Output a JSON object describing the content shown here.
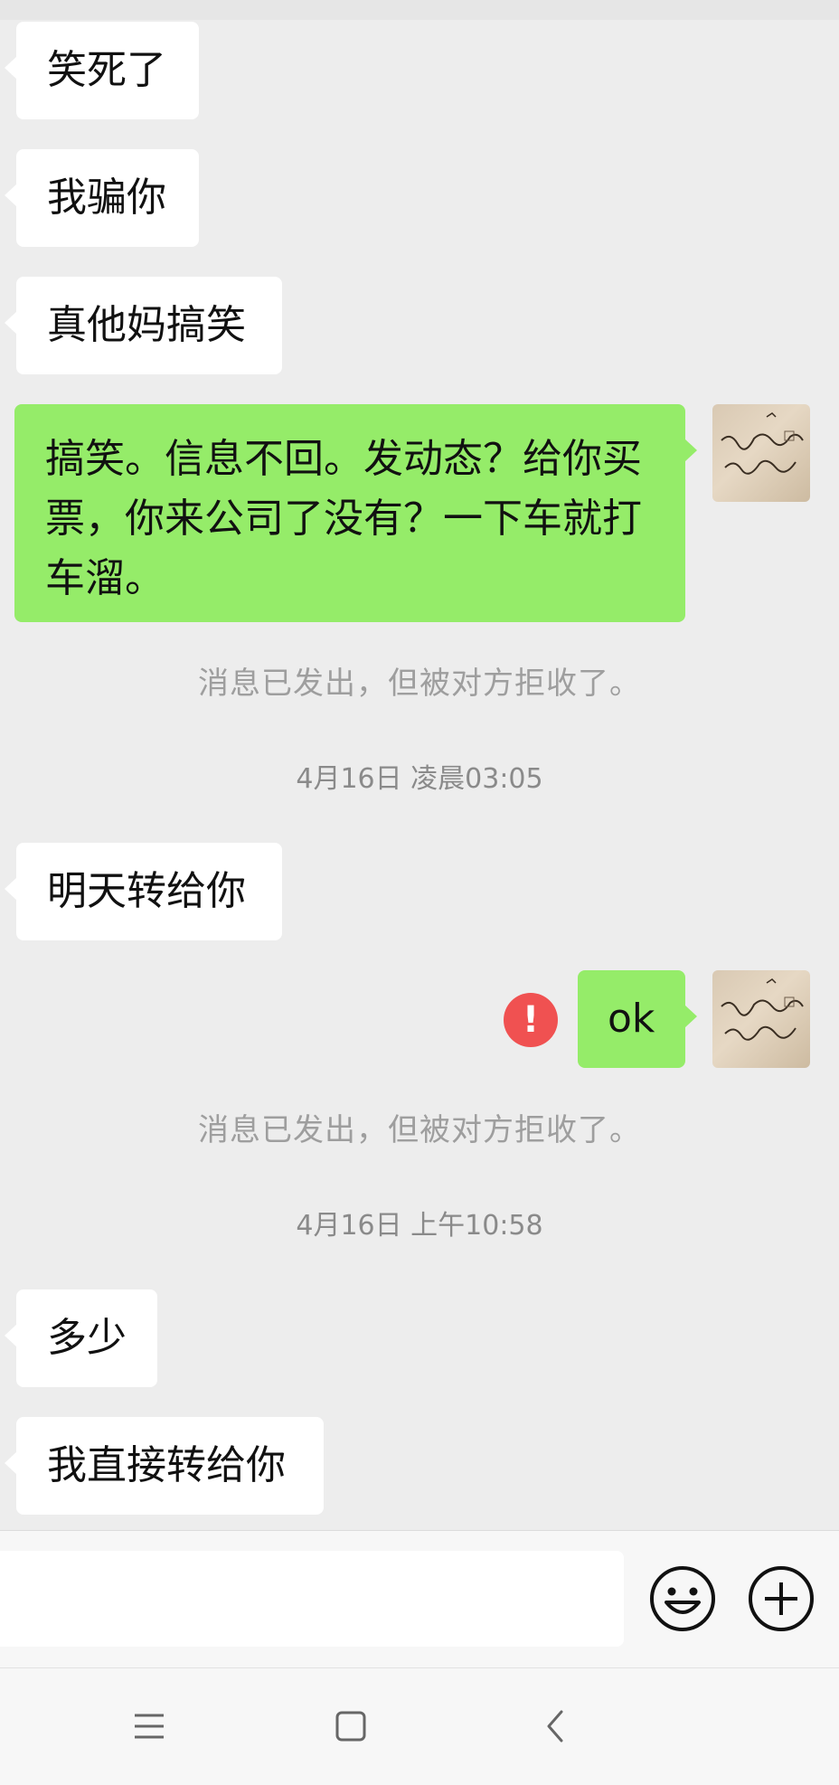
{
  "messages": [
    {
      "side": "in",
      "text": "笑死了"
    },
    {
      "side": "in",
      "text": "我骗你"
    },
    {
      "side": "in",
      "text": "真他妈搞笑"
    },
    {
      "side": "out",
      "text": "搞笑。信息不回。发动态？给你买票，你来公司了没有？一下车就打车溜。"
    },
    {
      "side": "in",
      "text": "明天转给你"
    },
    {
      "side": "out",
      "text": "ok"
    },
    {
      "side": "in",
      "text": "多少"
    },
    {
      "side": "in",
      "text": "我直接转给你"
    }
  ],
  "system_notes": [
    "消息已发出，但被对方拒收了。",
    "消息已发出，但被对方拒收了。"
  ],
  "timestamps": [
    "4月16日 凌晨03:05",
    "4月16日 上午10:58"
  ],
  "error_icon_symbol": "!",
  "colors": {
    "outgoing_bubble": "#95ec69",
    "incoming_bubble": "#ffffff",
    "background": "#ededed",
    "error": "#f05151"
  },
  "icons": {
    "emoji": "smiley-icon",
    "more": "plus-circle-icon",
    "nav_menu": "menu-icon",
    "nav_home": "home-square-icon",
    "nav_back": "back-chevron-icon"
  }
}
